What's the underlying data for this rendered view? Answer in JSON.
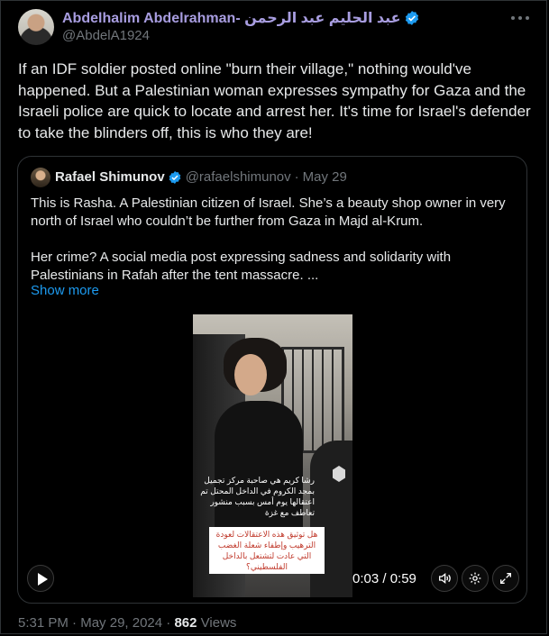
{
  "author": {
    "name": "Abdelhalim Abdelrahman- عبد الحليم عبد الرحمن",
    "handle": "@AbdelA1924",
    "verified": true
  },
  "tweet": {
    "text": "If an IDF soldier posted online \"burn their  village,\" nothing would've happened. But a Palestinian woman expresses sympathy for Gaza and the Israeli police are quick to locate and arrest her. It's time for Israel's defender to take the blinders off, this is who they are!"
  },
  "quote": {
    "name": "Rafael Shimunov",
    "handle": "@rafaelshimunov",
    "separator": "·",
    "date": "May 29",
    "paragraph1": "This is Rasha. A Palestinian citizen of Israel. She’s a beauty shop owner in very north of Israel who couldn’t be further from Gaza in Majd al-Krum.",
    "paragraph2": "Her crime? A social media post expressing sadness and solidarity with Palestinians in Rafah after the tent massacre. ...",
    "show_more": "Show more"
  },
  "video": {
    "caption_white": "رشا كريم هي صاحبة مركز تجميل بمجد الكروم في الداخل المحتل تم اعتقالها يوم أمس بسبب منشور تعاطف مع غزة",
    "caption_red": "هل توثيق هذه الاعتقالات لعودة الترهيب وإطفاء شعلة الغضب التي عادت لتشتعل بالداخل الفلسطيني؟",
    "timecode": "0:03 / 0:59"
  },
  "footer": {
    "time": "5:31 PM",
    "separator1": "·",
    "date": "May 29, 2024",
    "separator2": "·",
    "views_count": "862",
    "views_label": "Views"
  },
  "colors": {
    "background": "#000000",
    "name_accent": "#a89de0",
    "link": "#1d9bf0",
    "muted": "#71767b",
    "verified": "#1d9bf0"
  }
}
